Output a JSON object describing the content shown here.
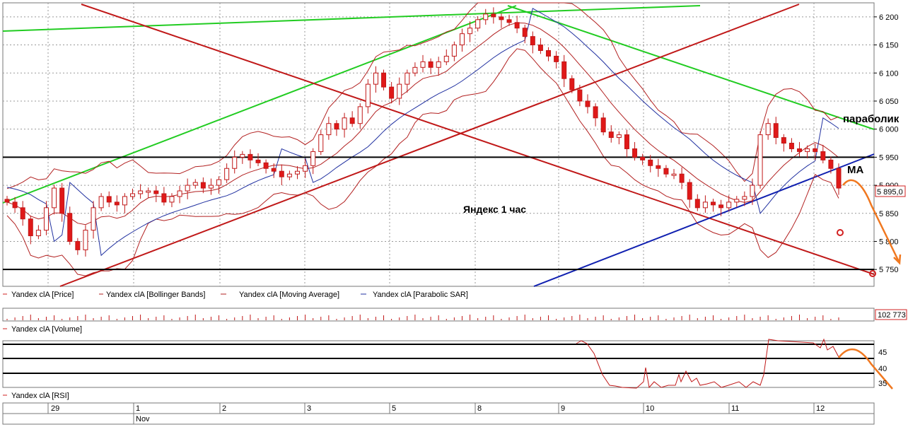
{
  "chart_data": {
    "type": "candlestick",
    "title": "Яндекс   1 час",
    "price_axis": {
      "ylim": [
        5720,
        6225
      ],
      "ticks": [
        "6 200",
        "6 150",
        "6 100",
        "6 050",
        "6 000",
        "5 950",
        "5 900",
        "5 850",
        "5 800",
        "5 750"
      ]
    },
    "last_price_label": "5 895,0",
    "volume_label": "102 773",
    "rsi_axis": {
      "ticks": [
        "45",
        "40",
        "35"
      ]
    },
    "legend_price": [
      {
        "name": "Yandex clA [Price]",
        "color": "#d22020"
      },
      {
        "name": "Yandex clA [Bollinger Bands]",
        "color": "#b22020"
      },
      {
        "name": "Yandex clA [Moving Average]",
        "color": "#b22020"
      },
      {
        "name": "Yandex clA [Parabolic SAR]",
        "color": "#2030a0"
      }
    ],
    "legend_volume": "Yandex clA [Volume]",
    "legend_rsi": "Yandex clA [RSI]",
    "dates": [
      "29",
      "1",
      "2",
      "3",
      "5",
      "8",
      "9",
      "10",
      "11",
      "12"
    ],
    "month_label": "Nov",
    "annotations": {
      "parabolic": "параболик",
      "ma": "МА"
    },
    "horizontal_levels": [
      5950,
      5750
    ],
    "closes": [
      5870,
      5860,
      5840,
      5810,
      5820,
      5860,
      5895,
      5850,
      5800,
      5785,
      5820,
      5860,
      5880,
      5870,
      5865,
      5880,
      5885,
      5890,
      5890,
      5885,
      5870,
      5880,
      5890,
      5900,
      5905,
      5895,
      5900,
      5910,
      5930,
      5950,
      5955,
      5945,
      5940,
      5930,
      5925,
      5915,
      5920,
      5925,
      5935,
      5960,
      5990,
      6010,
      6000,
      6020,
      6010,
      6040,
      6080,
      6100,
      6075,
      6055,
      6080,
      6100,
      6110,
      6120,
      6110,
      6120,
      6130,
      6150,
      6170,
      6180,
      6195,
      6205,
      6200,
      6195,
      6190,
      6180,
      6165,
      6150,
      6140,
      6130,
      6120,
      6090,
      6070,
      6050,
      6040,
      6020,
      5995,
      5985,
      5990,
      5965,
      5950,
      5945,
      5935,
      5930,
      5920,
      5920,
      5905,
      5875,
      5860,
      5870,
      5865,
      5860,
      5870,
      5875,
      5880,
      5900,
      5990,
      6010,
      5985,
      5975,
      5965,
      5960,
      5965,
      5960,
      5945,
      5930,
      5895
    ]
  }
}
